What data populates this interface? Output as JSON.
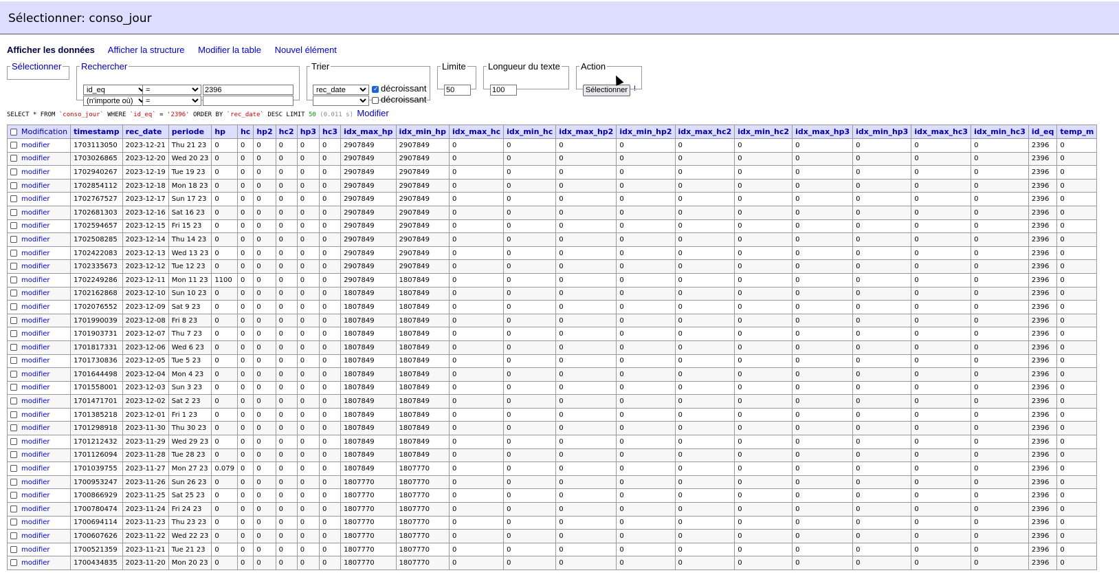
{
  "header": {
    "title": "Sélectionner: conso_jour"
  },
  "links": [
    "Afficher les données",
    "Afficher la structure",
    "Modifier la table",
    "Nouvel élément"
  ],
  "form": {
    "select_legend": "Sélectionner",
    "search_legend": "Rechercher",
    "search_row1": {
      "column": "id_eq",
      "operator": "=",
      "value": "2396"
    },
    "search_row2": {
      "column": "(n'importe où)",
      "operator": "=",
      "value": ""
    },
    "sort_legend": "Trier",
    "sort_row1": {
      "column": "rec_date",
      "desc_label": "décroissant",
      "desc_checked": true
    },
    "sort_row2": {
      "column": "",
      "desc_label": "décroissant",
      "desc_checked": false
    },
    "limit_legend": "Limite",
    "limit_value": "50",
    "textlen_legend": "Longueur du texte",
    "textlen_value": "100",
    "action_legend": "Action",
    "action_button": "Sélectionner",
    "action_extra": "!"
  },
  "sql": {
    "prefix": "SELECT * FROM ",
    "table": "`conso_jour`",
    "where": " WHERE ",
    "col": "`id_eq`",
    "eq": " = ",
    "val": "'2396'",
    "order": " ORDER BY ",
    "ordcol": "`rec_date`",
    "tail": " DESC LIMIT ",
    "limit": "50",
    "time": "(0.011 s)",
    "modify_link": "Modifier"
  },
  "table": {
    "columns": [
      "Modification",
      "timestamp",
      "rec_date",
      "periode",
      "hp",
      "hc",
      "hp2",
      "hc2",
      "hp3",
      "hc3",
      "idx_max_hp",
      "idx_min_hp",
      "idx_max_hc",
      "idx_min_hc",
      "idx_max_hp2",
      "idx_min_hp2",
      "idx_max_hc2",
      "idx_min_hc2",
      "idx_max_hp3",
      "idx_min_hp3",
      "idx_max_hc3",
      "idx_min_hc3",
      "id_eq",
      "temp_m"
    ],
    "modify_label": "modifier",
    "rows": [
      [
        "1703113050",
        "2023-12-21",
        "Thu 21 23",
        "0",
        "2907849",
        "2907849"
      ],
      [
        "1703026865",
        "2023-12-20",
        "Wed 20 23",
        "0",
        "2907849",
        "2907849"
      ],
      [
        "1702940267",
        "2023-12-19",
        "Tue 19 23",
        "0",
        "2907849",
        "2907849"
      ],
      [
        "1702854112",
        "2023-12-18",
        "Mon 18 23",
        "0",
        "2907849",
        "2907849"
      ],
      [
        "1702767527",
        "2023-12-17",
        "Sun 17 23",
        "0",
        "2907849",
        "2907849"
      ],
      [
        "1702681303",
        "2023-12-16",
        "Sat 16 23",
        "0",
        "2907849",
        "2907849"
      ],
      [
        "1702594657",
        "2023-12-15",
        "Fri 15 23",
        "0",
        "2907849",
        "2907849"
      ],
      [
        "1702508285",
        "2023-12-14",
        "Thu 14 23",
        "0",
        "2907849",
        "2907849"
      ],
      [
        "1702422083",
        "2023-12-13",
        "Wed 13 23",
        "0",
        "2907849",
        "2907849"
      ],
      [
        "1702335673",
        "2023-12-12",
        "Tue 12 23",
        "0",
        "2907849",
        "2907849"
      ],
      [
        "1702249286",
        "2023-12-11",
        "Mon 11 23",
        "1100",
        "2907849",
        "1807849"
      ],
      [
        "1702162868",
        "2023-12-10",
        "Sun 10 23",
        "0",
        "1807849",
        "1807849"
      ],
      [
        "1702076552",
        "2023-12-09",
        "Sat 9 23",
        "0",
        "1807849",
        "1807849"
      ],
      [
        "1701990039",
        "2023-12-08",
        "Fri 8 23",
        "0",
        "1807849",
        "1807849"
      ],
      [
        "1701903731",
        "2023-12-07",
        "Thu 7 23",
        "0",
        "1807849",
        "1807849"
      ],
      [
        "1701817331",
        "2023-12-06",
        "Wed 6 23",
        "0",
        "1807849",
        "1807849"
      ],
      [
        "1701730836",
        "2023-12-05",
        "Tue 5 23",
        "0",
        "1807849",
        "1807849"
      ],
      [
        "1701644498",
        "2023-12-04",
        "Mon 4 23",
        "0",
        "1807849",
        "1807849"
      ],
      [
        "1701558001",
        "2023-12-03",
        "Sun 3 23",
        "0",
        "1807849",
        "1807849"
      ],
      [
        "1701471701",
        "2023-12-02",
        "Sat 2 23",
        "0",
        "1807849",
        "1807849"
      ],
      [
        "1701385218",
        "2023-12-01",
        "Fri 1 23",
        "0",
        "1807849",
        "1807849"
      ],
      [
        "1701298918",
        "2023-11-30",
        "Thu 30 23",
        "0",
        "1807849",
        "1807849"
      ],
      [
        "1701212432",
        "2023-11-29",
        "Wed 29 23",
        "0",
        "1807849",
        "1807849"
      ],
      [
        "1701126094",
        "2023-11-28",
        "Tue 28 23",
        "0",
        "1807849",
        "1807849"
      ],
      [
        "1701039755",
        "2023-11-27",
        "Mon 27 23",
        "0.079",
        "1807849",
        "1807770"
      ],
      [
        "1700953247",
        "2023-11-26",
        "Sun 26 23",
        "0",
        "1807770",
        "1807770"
      ],
      [
        "1700866929",
        "2023-11-25",
        "Sat 25 23",
        "0",
        "1807770",
        "1807770"
      ],
      [
        "1700780474",
        "2023-11-24",
        "Fri 24 23",
        "0",
        "1807770",
        "1807770"
      ],
      [
        "1700694114",
        "2023-11-23",
        "Thu 23 23",
        "0",
        "1807770",
        "1807770"
      ],
      [
        "1700607626",
        "2023-11-22",
        "Wed 22 23",
        "0",
        "1807770",
        "1807770"
      ],
      [
        "1700521359",
        "2023-11-21",
        "Tue 21 23",
        "0",
        "1807770",
        "1807770"
      ],
      [
        "1700434835",
        "2023-11-20",
        "Mon 20 23",
        "0",
        "1807770",
        "1807770"
      ]
    ],
    "zero": "0",
    "id_eq": "2396"
  }
}
